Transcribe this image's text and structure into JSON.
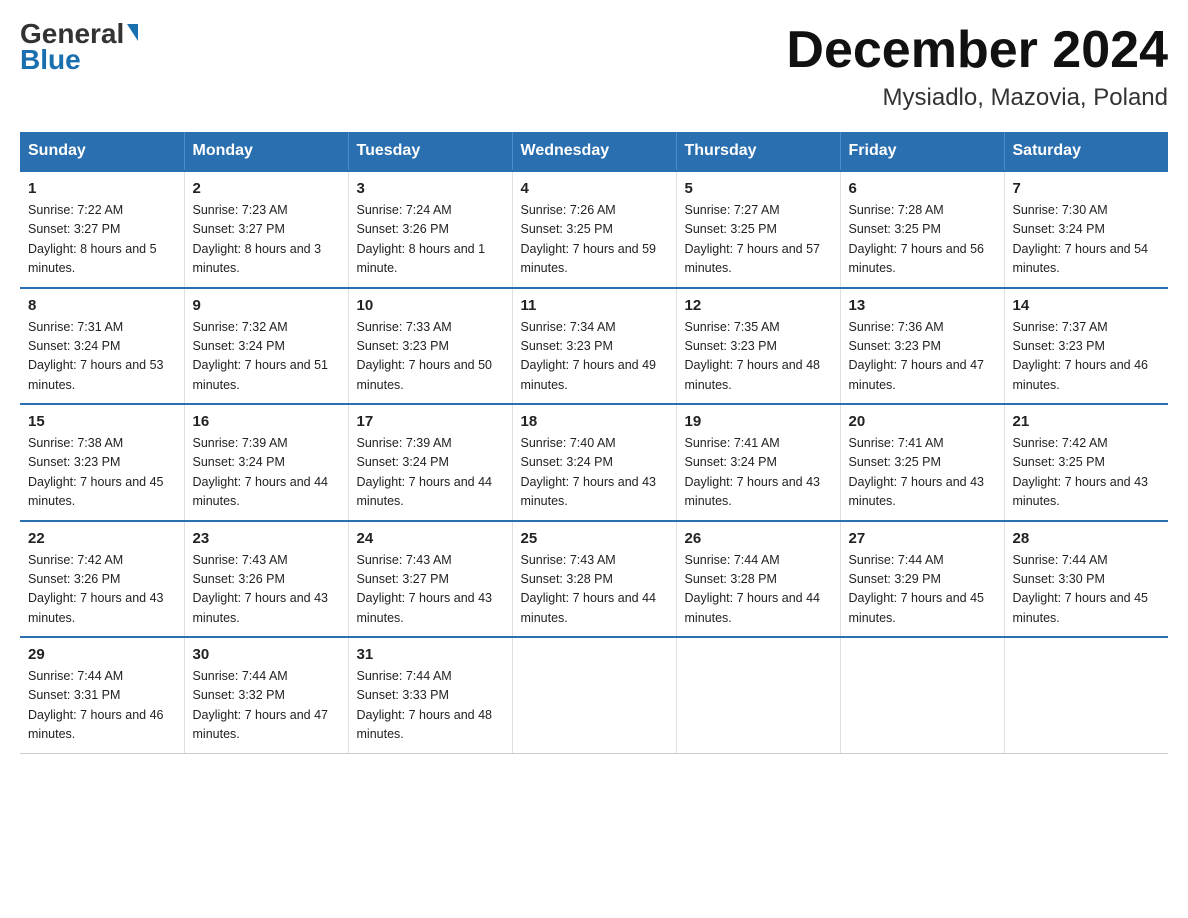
{
  "logo": {
    "general": "General",
    "arrow": "▶",
    "blue": "Blue"
  },
  "header": {
    "month": "December 2024",
    "location": "Mysiadlo, Mazovia, Poland"
  },
  "days_of_week": [
    "Sunday",
    "Monday",
    "Tuesday",
    "Wednesday",
    "Thursday",
    "Friday",
    "Saturday"
  ],
  "weeks": [
    [
      {
        "num": "1",
        "sunrise": "7:22 AM",
        "sunset": "3:27 PM",
        "daylight": "8 hours and 5 minutes."
      },
      {
        "num": "2",
        "sunrise": "7:23 AM",
        "sunset": "3:27 PM",
        "daylight": "8 hours and 3 minutes."
      },
      {
        "num": "3",
        "sunrise": "7:24 AM",
        "sunset": "3:26 PM",
        "daylight": "8 hours and 1 minute."
      },
      {
        "num": "4",
        "sunrise": "7:26 AM",
        "sunset": "3:25 PM",
        "daylight": "7 hours and 59 minutes."
      },
      {
        "num": "5",
        "sunrise": "7:27 AM",
        "sunset": "3:25 PM",
        "daylight": "7 hours and 57 minutes."
      },
      {
        "num": "6",
        "sunrise": "7:28 AM",
        "sunset": "3:25 PM",
        "daylight": "7 hours and 56 minutes."
      },
      {
        "num": "7",
        "sunrise": "7:30 AM",
        "sunset": "3:24 PM",
        "daylight": "7 hours and 54 minutes."
      }
    ],
    [
      {
        "num": "8",
        "sunrise": "7:31 AM",
        "sunset": "3:24 PM",
        "daylight": "7 hours and 53 minutes."
      },
      {
        "num": "9",
        "sunrise": "7:32 AM",
        "sunset": "3:24 PM",
        "daylight": "7 hours and 51 minutes."
      },
      {
        "num": "10",
        "sunrise": "7:33 AM",
        "sunset": "3:23 PM",
        "daylight": "7 hours and 50 minutes."
      },
      {
        "num": "11",
        "sunrise": "7:34 AM",
        "sunset": "3:23 PM",
        "daylight": "7 hours and 49 minutes."
      },
      {
        "num": "12",
        "sunrise": "7:35 AM",
        "sunset": "3:23 PM",
        "daylight": "7 hours and 48 minutes."
      },
      {
        "num": "13",
        "sunrise": "7:36 AM",
        "sunset": "3:23 PM",
        "daylight": "7 hours and 47 minutes."
      },
      {
        "num": "14",
        "sunrise": "7:37 AM",
        "sunset": "3:23 PM",
        "daylight": "7 hours and 46 minutes."
      }
    ],
    [
      {
        "num": "15",
        "sunrise": "7:38 AM",
        "sunset": "3:23 PM",
        "daylight": "7 hours and 45 minutes."
      },
      {
        "num": "16",
        "sunrise": "7:39 AM",
        "sunset": "3:24 PM",
        "daylight": "7 hours and 44 minutes."
      },
      {
        "num": "17",
        "sunrise": "7:39 AM",
        "sunset": "3:24 PM",
        "daylight": "7 hours and 44 minutes."
      },
      {
        "num": "18",
        "sunrise": "7:40 AM",
        "sunset": "3:24 PM",
        "daylight": "7 hours and 43 minutes."
      },
      {
        "num": "19",
        "sunrise": "7:41 AM",
        "sunset": "3:24 PM",
        "daylight": "7 hours and 43 minutes."
      },
      {
        "num": "20",
        "sunrise": "7:41 AM",
        "sunset": "3:25 PM",
        "daylight": "7 hours and 43 minutes."
      },
      {
        "num": "21",
        "sunrise": "7:42 AM",
        "sunset": "3:25 PM",
        "daylight": "7 hours and 43 minutes."
      }
    ],
    [
      {
        "num": "22",
        "sunrise": "7:42 AM",
        "sunset": "3:26 PM",
        "daylight": "7 hours and 43 minutes."
      },
      {
        "num": "23",
        "sunrise": "7:43 AM",
        "sunset": "3:26 PM",
        "daylight": "7 hours and 43 minutes."
      },
      {
        "num": "24",
        "sunrise": "7:43 AM",
        "sunset": "3:27 PM",
        "daylight": "7 hours and 43 minutes."
      },
      {
        "num": "25",
        "sunrise": "7:43 AM",
        "sunset": "3:28 PM",
        "daylight": "7 hours and 44 minutes."
      },
      {
        "num": "26",
        "sunrise": "7:44 AM",
        "sunset": "3:28 PM",
        "daylight": "7 hours and 44 minutes."
      },
      {
        "num": "27",
        "sunrise": "7:44 AM",
        "sunset": "3:29 PM",
        "daylight": "7 hours and 45 minutes."
      },
      {
        "num": "28",
        "sunrise": "7:44 AM",
        "sunset": "3:30 PM",
        "daylight": "7 hours and 45 minutes."
      }
    ],
    [
      {
        "num": "29",
        "sunrise": "7:44 AM",
        "sunset": "3:31 PM",
        "daylight": "7 hours and 46 minutes."
      },
      {
        "num": "30",
        "sunrise": "7:44 AM",
        "sunset": "3:32 PM",
        "daylight": "7 hours and 47 minutes."
      },
      {
        "num": "31",
        "sunrise": "7:44 AM",
        "sunset": "3:33 PM",
        "daylight": "7 hours and 48 minutes."
      },
      null,
      null,
      null,
      null
    ]
  ]
}
